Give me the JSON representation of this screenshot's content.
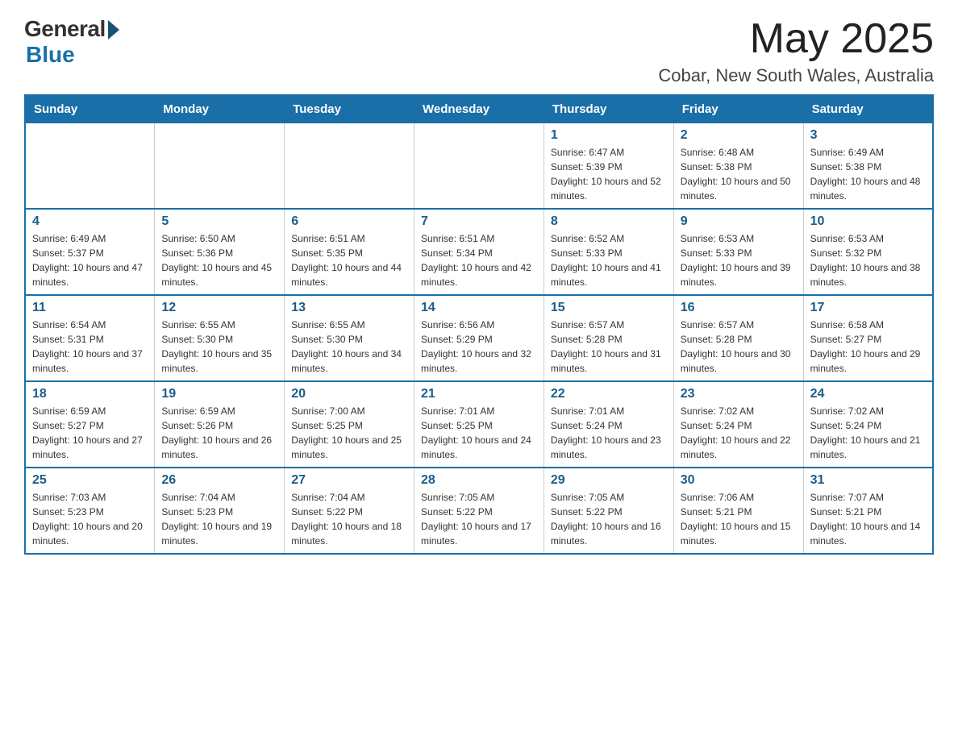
{
  "header": {
    "logo_general": "General",
    "logo_blue": "Blue",
    "month_title": "May 2025",
    "location": "Cobar, New South Wales, Australia"
  },
  "weekdays": [
    "Sunday",
    "Monday",
    "Tuesday",
    "Wednesday",
    "Thursday",
    "Friday",
    "Saturday"
  ],
  "weeks": [
    {
      "days": [
        {
          "number": "",
          "info": ""
        },
        {
          "number": "",
          "info": ""
        },
        {
          "number": "",
          "info": ""
        },
        {
          "number": "",
          "info": ""
        },
        {
          "number": "1",
          "info": "Sunrise: 6:47 AM\nSunset: 5:39 PM\nDaylight: 10 hours and 52 minutes."
        },
        {
          "number": "2",
          "info": "Sunrise: 6:48 AM\nSunset: 5:38 PM\nDaylight: 10 hours and 50 minutes."
        },
        {
          "number": "3",
          "info": "Sunrise: 6:49 AM\nSunset: 5:38 PM\nDaylight: 10 hours and 48 minutes."
        }
      ]
    },
    {
      "days": [
        {
          "number": "4",
          "info": "Sunrise: 6:49 AM\nSunset: 5:37 PM\nDaylight: 10 hours and 47 minutes."
        },
        {
          "number": "5",
          "info": "Sunrise: 6:50 AM\nSunset: 5:36 PM\nDaylight: 10 hours and 45 minutes."
        },
        {
          "number": "6",
          "info": "Sunrise: 6:51 AM\nSunset: 5:35 PM\nDaylight: 10 hours and 44 minutes."
        },
        {
          "number": "7",
          "info": "Sunrise: 6:51 AM\nSunset: 5:34 PM\nDaylight: 10 hours and 42 minutes."
        },
        {
          "number": "8",
          "info": "Sunrise: 6:52 AM\nSunset: 5:33 PM\nDaylight: 10 hours and 41 minutes."
        },
        {
          "number": "9",
          "info": "Sunrise: 6:53 AM\nSunset: 5:33 PM\nDaylight: 10 hours and 39 minutes."
        },
        {
          "number": "10",
          "info": "Sunrise: 6:53 AM\nSunset: 5:32 PM\nDaylight: 10 hours and 38 minutes."
        }
      ]
    },
    {
      "days": [
        {
          "number": "11",
          "info": "Sunrise: 6:54 AM\nSunset: 5:31 PM\nDaylight: 10 hours and 37 minutes."
        },
        {
          "number": "12",
          "info": "Sunrise: 6:55 AM\nSunset: 5:30 PM\nDaylight: 10 hours and 35 minutes."
        },
        {
          "number": "13",
          "info": "Sunrise: 6:55 AM\nSunset: 5:30 PM\nDaylight: 10 hours and 34 minutes."
        },
        {
          "number": "14",
          "info": "Sunrise: 6:56 AM\nSunset: 5:29 PM\nDaylight: 10 hours and 32 minutes."
        },
        {
          "number": "15",
          "info": "Sunrise: 6:57 AM\nSunset: 5:28 PM\nDaylight: 10 hours and 31 minutes."
        },
        {
          "number": "16",
          "info": "Sunrise: 6:57 AM\nSunset: 5:28 PM\nDaylight: 10 hours and 30 minutes."
        },
        {
          "number": "17",
          "info": "Sunrise: 6:58 AM\nSunset: 5:27 PM\nDaylight: 10 hours and 29 minutes."
        }
      ]
    },
    {
      "days": [
        {
          "number": "18",
          "info": "Sunrise: 6:59 AM\nSunset: 5:27 PM\nDaylight: 10 hours and 27 minutes."
        },
        {
          "number": "19",
          "info": "Sunrise: 6:59 AM\nSunset: 5:26 PM\nDaylight: 10 hours and 26 minutes."
        },
        {
          "number": "20",
          "info": "Sunrise: 7:00 AM\nSunset: 5:25 PM\nDaylight: 10 hours and 25 minutes."
        },
        {
          "number": "21",
          "info": "Sunrise: 7:01 AM\nSunset: 5:25 PM\nDaylight: 10 hours and 24 minutes."
        },
        {
          "number": "22",
          "info": "Sunrise: 7:01 AM\nSunset: 5:24 PM\nDaylight: 10 hours and 23 minutes."
        },
        {
          "number": "23",
          "info": "Sunrise: 7:02 AM\nSunset: 5:24 PM\nDaylight: 10 hours and 22 minutes."
        },
        {
          "number": "24",
          "info": "Sunrise: 7:02 AM\nSunset: 5:24 PM\nDaylight: 10 hours and 21 minutes."
        }
      ]
    },
    {
      "days": [
        {
          "number": "25",
          "info": "Sunrise: 7:03 AM\nSunset: 5:23 PM\nDaylight: 10 hours and 20 minutes."
        },
        {
          "number": "26",
          "info": "Sunrise: 7:04 AM\nSunset: 5:23 PM\nDaylight: 10 hours and 19 minutes."
        },
        {
          "number": "27",
          "info": "Sunrise: 7:04 AM\nSunset: 5:22 PM\nDaylight: 10 hours and 18 minutes."
        },
        {
          "number": "28",
          "info": "Sunrise: 7:05 AM\nSunset: 5:22 PM\nDaylight: 10 hours and 17 minutes."
        },
        {
          "number": "29",
          "info": "Sunrise: 7:05 AM\nSunset: 5:22 PM\nDaylight: 10 hours and 16 minutes."
        },
        {
          "number": "30",
          "info": "Sunrise: 7:06 AM\nSunset: 5:21 PM\nDaylight: 10 hours and 15 minutes."
        },
        {
          "number": "31",
          "info": "Sunrise: 7:07 AM\nSunset: 5:21 PM\nDaylight: 10 hours and 14 minutes."
        }
      ]
    }
  ]
}
